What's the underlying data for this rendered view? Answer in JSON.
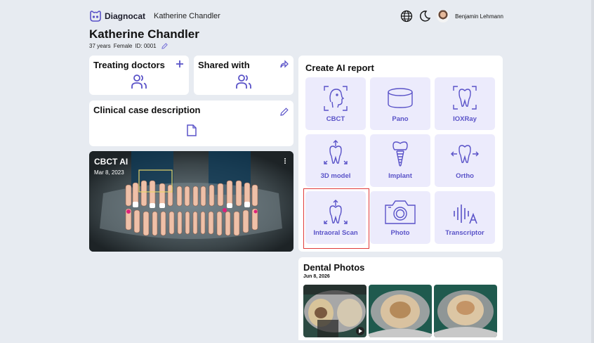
{
  "header": {
    "brand": "Diagnocat",
    "breadcrumb": "Katherine Chandler",
    "user_name": "Benjamin Lehmann",
    "icons": [
      "globe-icon",
      "moon-icon",
      "avatar"
    ]
  },
  "patient": {
    "name": "Katherine Chandler",
    "age": "37 years",
    "gender": "Female",
    "id": "ID: 0001"
  },
  "cards": {
    "treating_doctors": "Treating doctors",
    "shared_with": "Shared with",
    "clinical_case": "Clinical case description"
  },
  "study": {
    "title": "CBCT AI",
    "date": "Mar 8, 2023"
  },
  "report": {
    "title": "Create AI report",
    "tiles": [
      {
        "label": "CBCT",
        "icon": "cbct-face-icon"
      },
      {
        "label": "Pano",
        "icon": "pano-cylinder-icon"
      },
      {
        "label": "IOXRay",
        "icon": "ioxray-tooth-icon"
      },
      {
        "label": "3D model",
        "icon": "3d-model-tooth-icon"
      },
      {
        "label": "Implant",
        "icon": "implant-icon"
      },
      {
        "label": "Ortho",
        "icon": "ortho-tooth-icon"
      },
      {
        "label": "Intraoral Scan",
        "icon": "intraoral-scan-icon"
      },
      {
        "label": "Photo",
        "icon": "camera-icon"
      },
      {
        "label": "Transcriptor",
        "icon": "transcriptor-waveform-icon"
      }
    ]
  },
  "photos": {
    "title": "Dental Photos",
    "date": "Jun 8, 2026"
  },
  "colors": {
    "accent": "#5a53c8",
    "tile_bg": "#ecebfc",
    "page_bg": "#e7ebf1",
    "selection": "#e03b3b"
  }
}
